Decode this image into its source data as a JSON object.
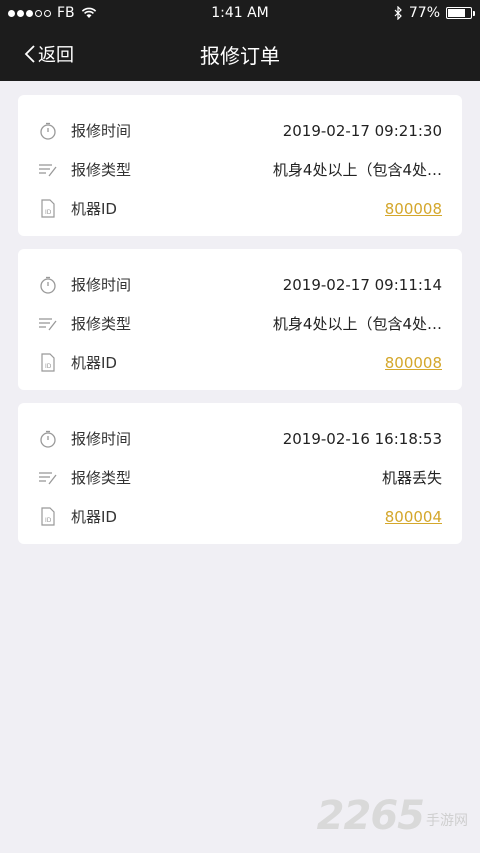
{
  "status_bar": {
    "carrier": "FB",
    "time": "1:41 AM",
    "battery_percent": "77%",
    "battery_level": 0.77
  },
  "nav": {
    "back_label": "返回",
    "title": "报修订单"
  },
  "orders": [
    {
      "time_label": "报修时间",
      "time_value": "2019-02-17 09:21:30",
      "type_label": "报修类型",
      "type_value": "机身4处以上（包含4处…",
      "id_label": "机器ID",
      "id_value": "800008"
    },
    {
      "time_label": "报修时间",
      "time_value": "2019-02-17 09:11:14",
      "type_label": "报修类型",
      "type_value": "机身4处以上（包含4处…",
      "id_label": "机器ID",
      "id_value": "800008"
    },
    {
      "time_label": "报修时间",
      "time_value": "2019-02-16 16:18:53",
      "type_label": "报修类型",
      "type_value": "机器丢失",
      "id_label": "机器ID",
      "id_value": "800004"
    }
  ],
  "watermark": {
    "number": "2265",
    "text": "手游网"
  },
  "colors": {
    "header_bg": "#1c1c1c",
    "page_bg": "#f0eff4",
    "link": "#d4a72c"
  }
}
